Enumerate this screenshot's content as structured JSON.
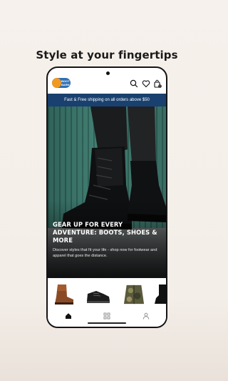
{
  "headline": "Style at your fingertips",
  "app": {
    "logo_text": "BOOT BARN",
    "cart_count": "0",
    "icons": [
      "search-icon",
      "heart-icon",
      "cart-icon"
    ]
  },
  "banner": {
    "text": "Fast & Free shipping on all orders above $50"
  },
  "hero": {
    "title": "GEAR UP FOR EVERY ADVENTURE: BOOTS, SHOES & MORE",
    "subtitle": "Discover styles that fit your life - shop now for footwear and apparel that goes the distance."
  },
  "products": [
    "brown-western-boot",
    "black-sneaker",
    "camo-jacket",
    "black-boot"
  ],
  "nav": {
    "items": [
      "home-icon",
      "grid-icon",
      "user-icon"
    ],
    "active": "home-icon"
  },
  "colors": {
    "banner": "#19406f",
    "accent": "#f29a1f",
    "brand": "#2f6fb3"
  }
}
